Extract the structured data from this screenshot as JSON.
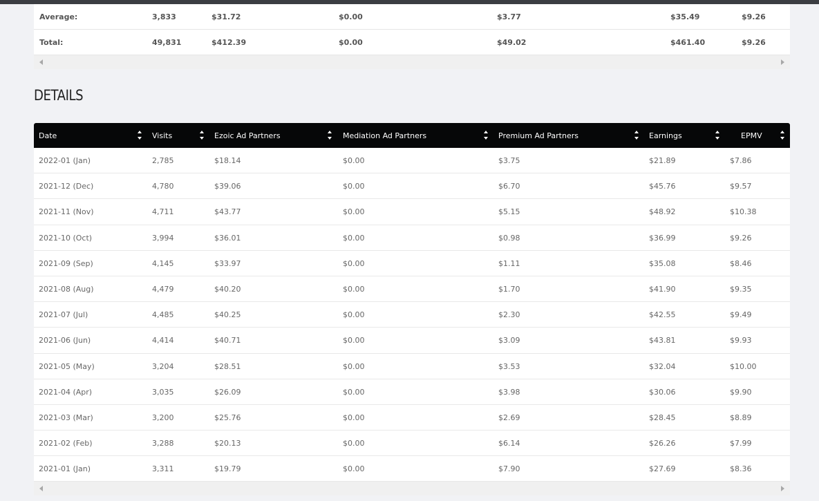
{
  "summary": {
    "rows": [
      {
        "label": "Average:",
        "visits": "3,833",
        "ezoic": "$31.72",
        "mediation": "$0.00",
        "premium": "$3.77",
        "earnings": "$35.49",
        "epmv": "$9.26"
      },
      {
        "label": "Total:",
        "visits": "49,831",
        "ezoic": "$412.39",
        "mediation": "$0.00",
        "premium": "$49.02",
        "earnings": "$461.40",
        "epmv": "$9.26"
      }
    ]
  },
  "details": {
    "title": "DETAILS",
    "columns": [
      "Date",
      "Visits",
      "Ezoic Ad Partners",
      "Mediation Ad Partners",
      "Premium Ad Partners",
      "Earnings",
      "EPMV"
    ],
    "rows": [
      {
        "date": "2022-01 (Jan)",
        "visits": "2,785",
        "ezoic": "$18.14",
        "mediation": "$0.00",
        "premium": "$3.75",
        "earnings": "$21.89",
        "epmv": "$7.86"
      },
      {
        "date": "2021-12 (Dec)",
        "visits": "4,780",
        "ezoic": "$39.06",
        "mediation": "$0.00",
        "premium": "$6.70",
        "earnings": "$45.76",
        "epmv": "$9.57"
      },
      {
        "date": "2021-11 (Nov)",
        "visits": "4,711",
        "ezoic": "$43.77",
        "mediation": "$0.00",
        "premium": "$5.15",
        "earnings": "$48.92",
        "epmv": "$10.38"
      },
      {
        "date": "2021-10 (Oct)",
        "visits": "3,994",
        "ezoic": "$36.01",
        "mediation": "$0.00",
        "premium": "$0.98",
        "earnings": "$36.99",
        "epmv": "$9.26"
      },
      {
        "date": "2021-09 (Sep)",
        "visits": "4,145",
        "ezoic": "$33.97",
        "mediation": "$0.00",
        "premium": "$1.11",
        "earnings": "$35.08",
        "epmv": "$8.46"
      },
      {
        "date": "2021-08 (Aug)",
        "visits": "4,479",
        "ezoic": "$40.20",
        "mediation": "$0.00",
        "premium": "$1.70",
        "earnings": "$41.90",
        "epmv": "$9.35"
      },
      {
        "date": "2021-07 (Jul)",
        "visits": "4,485",
        "ezoic": "$40.25",
        "mediation": "$0.00",
        "premium": "$2.30",
        "earnings": "$42.55",
        "epmv": "$9.49"
      },
      {
        "date": "2021-06 (Jun)",
        "visits": "4,414",
        "ezoic": "$40.71",
        "mediation": "$0.00",
        "premium": "$3.09",
        "earnings": "$43.81",
        "epmv": "$9.93"
      },
      {
        "date": "2021-05 (May)",
        "visits": "3,204",
        "ezoic": "$28.51",
        "mediation": "$0.00",
        "premium": "$3.53",
        "earnings": "$32.04",
        "epmv": "$10.00"
      },
      {
        "date": "2021-04 (Apr)",
        "visits": "3,035",
        "ezoic": "$26.09",
        "mediation": "$0.00",
        "premium": "$3.98",
        "earnings": "$30.06",
        "epmv": "$9.90"
      },
      {
        "date": "2021-03 (Mar)",
        "visits": "3,200",
        "ezoic": "$25.76",
        "mediation": "$0.00",
        "premium": "$2.69",
        "earnings": "$28.45",
        "epmv": "$8.89"
      },
      {
        "date": "2021-02 (Feb)",
        "visits": "3,288",
        "ezoic": "$20.13",
        "mediation": "$0.00",
        "premium": "$6.14",
        "earnings": "$26.26",
        "epmv": "$7.99"
      },
      {
        "date": "2021-01 (Jan)",
        "visits": "3,311",
        "ezoic": "$19.79",
        "mediation": "$0.00",
        "premium": "$7.90",
        "earnings": "$27.69",
        "epmv": "$8.36"
      }
    ]
  },
  "colors": {
    "header_bg": "#060708",
    "page_bg": "#f1f2f5",
    "topbar": "#3b3d42"
  },
  "icons": {
    "sort": "sort-arrows-icon",
    "scroll_left": "scroll-left-icon",
    "scroll_right": "scroll-right-icon"
  }
}
